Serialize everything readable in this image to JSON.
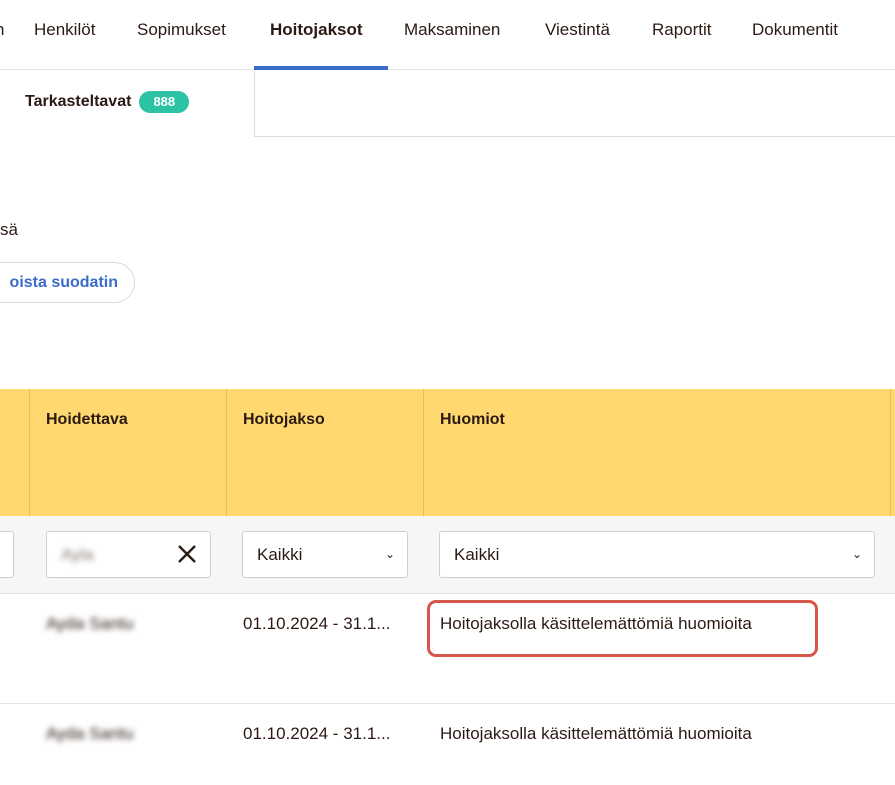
{
  "nav": {
    "items": [
      {
        "label": "n"
      },
      {
        "label": "Henkilöt"
      },
      {
        "label": "Sopimukset"
      },
      {
        "label": "Hoitojaksot"
      },
      {
        "label": "Maksaminen"
      },
      {
        "label": "Viestintä"
      },
      {
        "label": "Raportit"
      },
      {
        "label": "Dokumentit"
      }
    ]
  },
  "subtabs": {
    "review_label": "Tarkasteltavat",
    "review_count": "888"
  },
  "filters": {
    "partial_text": "sä",
    "clear_filter_label": "oista suodatin"
  },
  "table": {
    "columns": [
      "Hoidettava",
      "Hoitojakso",
      "Huomiot"
    ],
    "filters": {
      "hoidettava_value": "Ayla",
      "hoitojakso_value": "Kaikki",
      "huomiot_value": "Kaikki"
    },
    "rows": [
      {
        "hoidettava": "Ayda Santu",
        "hoitojakso": "01.10.2024 - 31.1...",
        "huomiot": "Hoitojaksolla käsittelemättömiä huomioita"
      },
      {
        "hoidettava": "Ayda Santu",
        "hoitojakso": "01.10.2024 - 31.1...",
        "huomiot": "Hoitojaksolla käsittelemättömiä huomioita"
      }
    ]
  },
  "colors": {
    "accent": "#3a6cc9",
    "header_bg": "#ffd970",
    "badge_bg": "#2cc2a3",
    "highlight_border": "#d4574a"
  }
}
